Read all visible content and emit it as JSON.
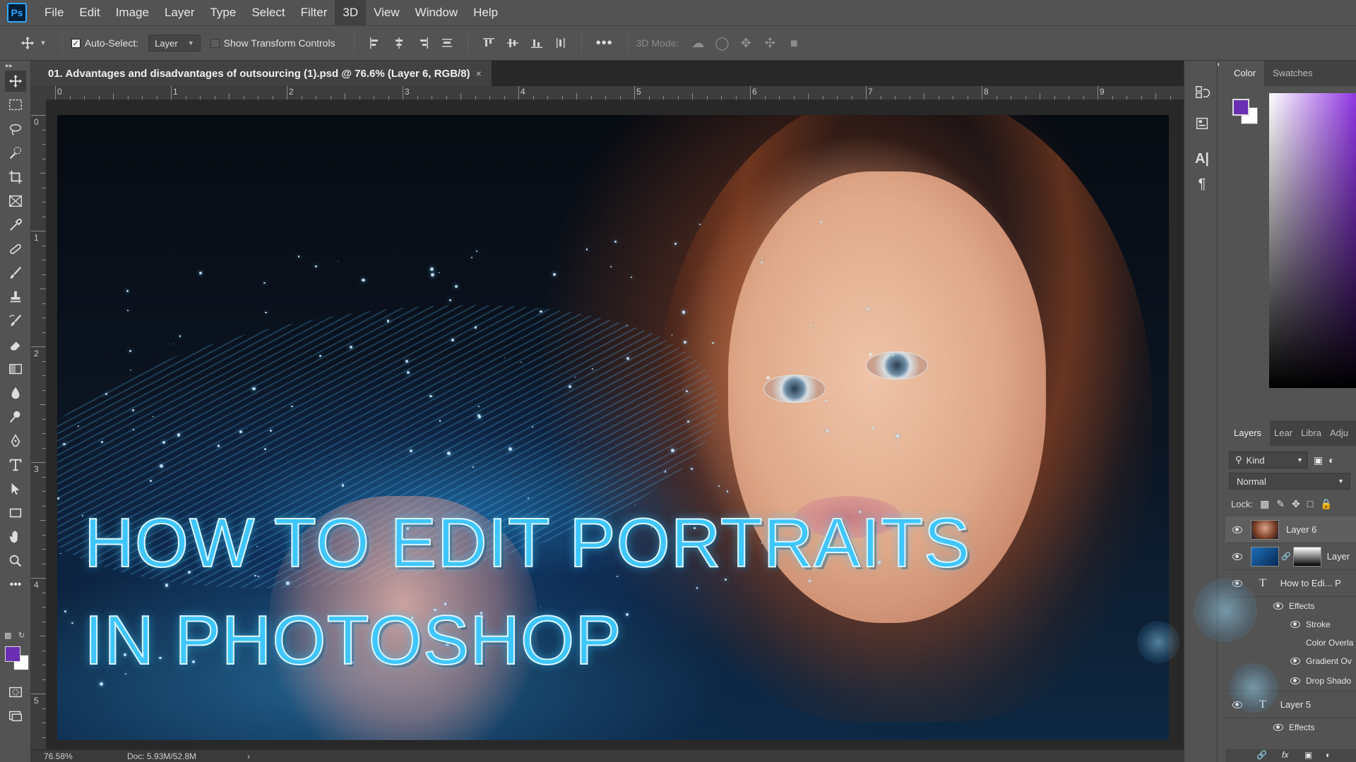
{
  "menubar": {
    "logo": "Ps",
    "items": [
      {
        "label": "File"
      },
      {
        "label": "Edit"
      },
      {
        "label": "Image"
      },
      {
        "label": "Layer"
      },
      {
        "label": "Type"
      },
      {
        "label": "Select"
      },
      {
        "label": "Filter"
      },
      {
        "label": "3D"
      },
      {
        "label": "View"
      },
      {
        "label": "Window"
      },
      {
        "label": "Help"
      }
    ]
  },
  "options": {
    "auto_select_label": "Auto-Select:",
    "auto_select_checked": true,
    "auto_select_target": "Layer",
    "show_transform_label": "Show Transform Controls",
    "show_transform_checked": false,
    "more_label": "•••",
    "mode_3d_label": "3D Mode:"
  },
  "document": {
    "tab_title": "01. Advantages and disadvantages of outsourcing (1).psd @ 76.6% (Layer 6, RGB/8)",
    "close_glyph": "×",
    "ruler_h_numbers": [
      "0",
      "1",
      "2",
      "3",
      "4",
      "5",
      "6",
      "7",
      "8",
      "9"
    ],
    "ruler_v_numbers": [
      "0",
      "1",
      "2",
      "3",
      "4",
      "5"
    ],
    "headline_line1": "HOW TO EDIT PORTRAITS",
    "headline_line2": "IN PHOTOSHOP"
  },
  "status": {
    "zoom": "76.58%",
    "doc_size": "Doc: 5.93M/52.8M",
    "arrow": "›"
  },
  "toolbar": {
    "fg_color": "#6a2fb3",
    "bg_color": "#ffffff",
    "more_label": "•••"
  },
  "color_panel": {
    "tabs": [
      "Color",
      "Swatches"
    ],
    "active_tab": "Color",
    "fg_color": "#6a2fb3",
    "bg_color": "#ffffff"
  },
  "layers_panel": {
    "tabs": [
      "Layers",
      "Lear",
      "Libra",
      "Adju"
    ],
    "active_tab": "Layers",
    "kind_label": "Kind",
    "blend_mode": "Normal",
    "lock_label": "Lock:",
    "layers": [
      {
        "name": "Layer 6",
        "type": "image",
        "visible": true,
        "selected": true
      },
      {
        "name": "Layer",
        "type": "image-mask",
        "visible": true,
        "selected": false
      },
      {
        "name": "How to Edi... P",
        "type": "text",
        "visible": true,
        "selected": false
      },
      {
        "name": "Effects",
        "type": "effects",
        "visible": true
      },
      {
        "name": "Stroke",
        "type": "effect",
        "visible": true
      },
      {
        "name": "Color Overla",
        "type": "effect",
        "visible": false
      },
      {
        "name": "Gradient Ov",
        "type": "effect",
        "visible": true
      },
      {
        "name": "Drop Shado",
        "type": "effect",
        "visible": true
      },
      {
        "name": "Layer 5",
        "type": "text",
        "visible": true,
        "selected": false
      },
      {
        "name": "Effects",
        "type": "effects",
        "visible": true
      }
    ],
    "footer_icons": [
      "link-icon",
      "fx-icon",
      "mask-icon",
      "adjustment-icon"
    ],
    "fx_label": "fx"
  },
  "accent_colors": {
    "headline": "#3fc6ff",
    "app_bg": "#535353",
    "canvas_bg": "#282828"
  }
}
